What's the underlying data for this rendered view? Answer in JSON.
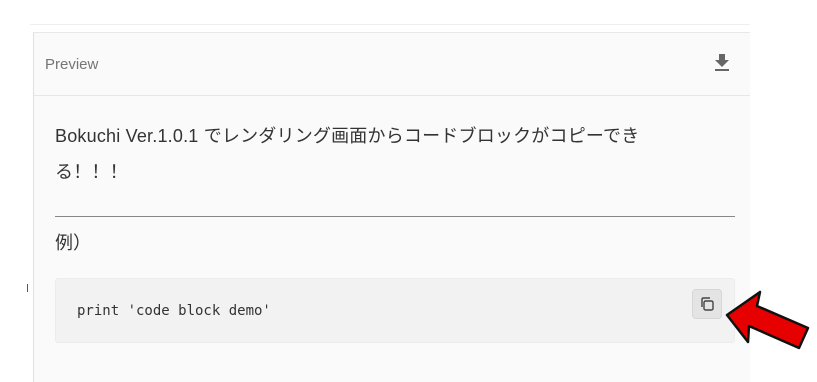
{
  "preview": {
    "title": "Preview",
    "download_icon": "download-icon"
  },
  "content": {
    "paragraph_line1": "Bokuchi Ver.1.0.1 でレンダリング画面からコードブロックがコピーでき",
    "paragraph_line2": "る！！！",
    "example_label": "例）"
  },
  "code_block": {
    "code": "print 'code block demo'",
    "copy_icon": "copy-icon"
  },
  "annotation": {
    "arrow_icon": "red-arrow-icon",
    "arrow_color": "#e60000"
  }
}
